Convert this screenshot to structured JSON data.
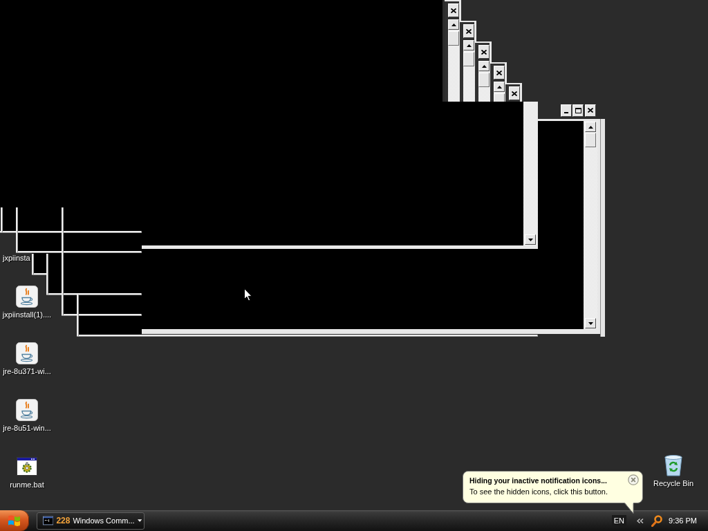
{
  "desktop": {
    "icons": [
      {
        "label": "jxpiinsta",
        "kind": "label_only"
      },
      {
        "label": "jxpiinstall(1)....",
        "kind": "java"
      },
      {
        "label": "jre-8u371-wi...",
        "kind": "java"
      },
      {
        "label": "jre-8u51-win...",
        "kind": "java"
      },
      {
        "label": "runme.bat",
        "kind": "batch"
      }
    ],
    "recycle_bin": {
      "label": "Recycle Bin"
    }
  },
  "notification": {
    "title": "Hiding your inactive notification icons...",
    "text": "To see the hidden icons, click this button."
  },
  "taskbar": {
    "task_button": {
      "count": "228",
      "label": "Windows Comm..."
    },
    "tray": {
      "language": "EN",
      "clock": "9:36 PM"
    }
  }
}
